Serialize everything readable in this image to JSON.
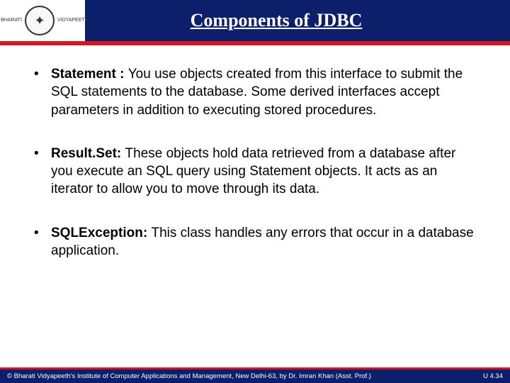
{
  "header": {
    "title": "Components of JDBC",
    "logo_text_left": "BHARATI",
    "logo_text_right": "VIDYAPEETH"
  },
  "bullets": [
    {
      "term": "Statement : ",
      "desc": "You use objects created from this interface to submit the SQL statements to the database. Some derived interfaces accept parameters in addition to executing stored procedures."
    },
    {
      "term": "Result.Set: ",
      "desc": "These objects hold data retrieved from a database after you execute an SQL query using Statement objects. It acts as an iterator to allow you to move through its data."
    },
    {
      "term": "SQLException: ",
      "desc": "This class handles any errors that occur in a database application."
    }
  ],
  "footer": {
    "copyright": "© Bharati Vidyapeeth's Institute of Computer Applications and Management, New Delhi-63, by Dr. Imran Khan (Asst. Prof.)",
    "page": "U 4.34"
  }
}
